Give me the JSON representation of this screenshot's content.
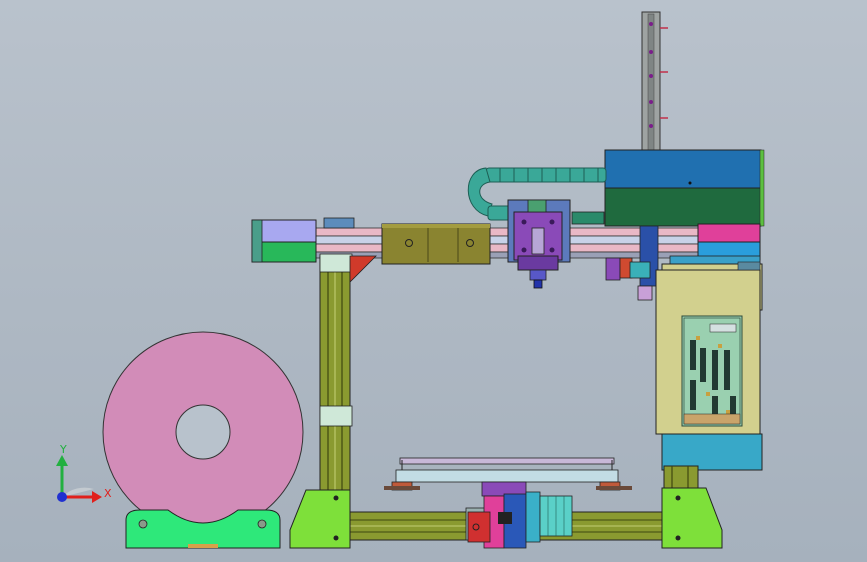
{
  "viewport": {
    "background_color": "#b0bac5"
  },
  "triad": {
    "x_label": "X",
    "y_label": "Y",
    "x_color": "#e0201c",
    "y_color": "#22b040",
    "z_color": "#2030d0"
  },
  "model": {
    "spool_color": "#d28cb8",
    "spool_base_color": "#2ee87a",
    "feet_color": "#7ee03a",
    "extrusion_color": "#8a9a30",
    "carriage_color": "#8a8430",
    "toolhead_color": "#8a4ab8",
    "cable_chain_color": "#3aa898",
    "electronics_box_color": "#d2d08e",
    "top_box_color": "#2070b0",
    "bed_color": "#c2dce4"
  }
}
